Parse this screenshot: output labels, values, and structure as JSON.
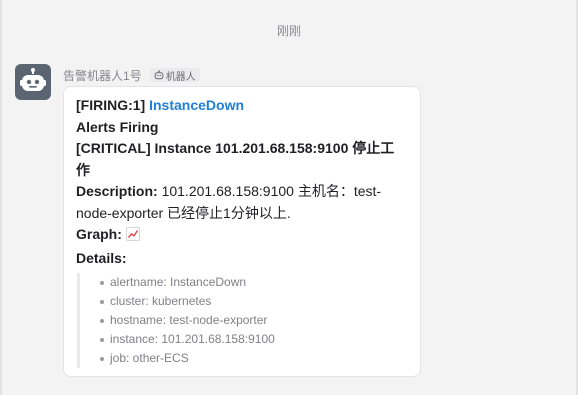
{
  "chat": {
    "timestamp": "刚刚",
    "sender": {
      "name": "告警机器人1号",
      "tag": "机器人",
      "avatar_icon": "robot-icon",
      "tag_icon": "robot-small-icon"
    },
    "message": {
      "firing_prefix": "[FIRING:1]",
      "alert_name": "InstanceDown",
      "alerts_heading": "Alerts Firing",
      "critical_line": "[CRITICAL] Instance 101.201.68.158:9100 停止工作",
      "description_label": "Description:",
      "description_text": "101.201.68.158:9100 主机名：test-node-exporter 已经停止1分钟以上.",
      "graph_label": "Graph:",
      "graph_icon": "chart-icon",
      "details_label": "Details:",
      "details": [
        "alertname: InstanceDown",
        "cluster: kubernetes",
        "hostname: test-node-exporter",
        "instance: 101.201.68.158:9100",
        "job: other-ECS"
      ]
    }
  },
  "colors": {
    "background": "#f3f3f4",
    "avatar": "#5b6572",
    "link": "#1f7fd6",
    "bubble": "#ffffff"
  }
}
